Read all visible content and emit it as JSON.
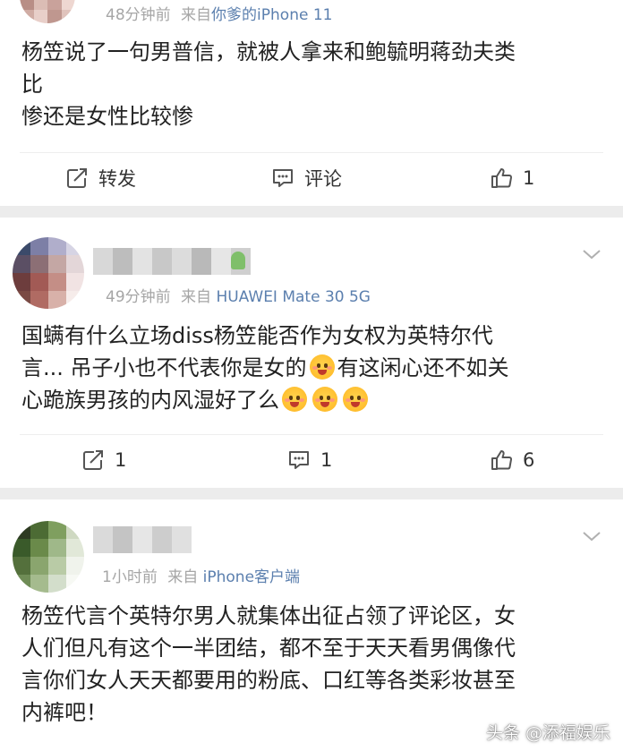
{
  "comments": [
    {
      "time": "48分钟前",
      "from_prefix": "来自",
      "source": "你爹的iPhone 11",
      "body_lines": [
        "杨笠说了一句男普信，就被人拿来和鲍毓明蒋劲夫类",
        "比",
        "惨还是女性比较惨"
      ],
      "repost_label": "转发",
      "comment_label": "评论",
      "like_count": "1"
    },
    {
      "time": "49分钟前",
      "from_prefix": "来自",
      "source": "HUAWEI Mate 30 5G",
      "body_line1": "国螨有什么立场diss杨笠能否作为女权为英特尔代",
      "body_line2a": "言... 吊子小也不代表你是女的",
      "body_line2b": "有这闲心还不如关",
      "body_line3": "心跪族男孩的内风湿好了么",
      "repost_count": "1",
      "comment_count": "1",
      "like_count": "6"
    },
    {
      "time": "1小时前",
      "from_prefix": "来自",
      "source": "iPhone客户端",
      "body_lines": [
        "杨笠代言个英特尔男人就集体出征占领了评论区，女",
        "人们但凡有这个一半团结，都不至于天天看男偶像代",
        "言你们女人天天都要用的粉底、口红等各类彩妆甚至",
        "内裤吧！"
      ]
    }
  ],
  "watermark": "头条 @添福娱乐",
  "colors": {
    "source_link": "#5b7fae",
    "meta": "#a6a6a6",
    "separator": "#ececec"
  },
  "icons": [
    "repost-icon",
    "comment-icon",
    "thumbs-up-icon",
    "chevron-down-icon",
    "emoji-icon"
  ]
}
